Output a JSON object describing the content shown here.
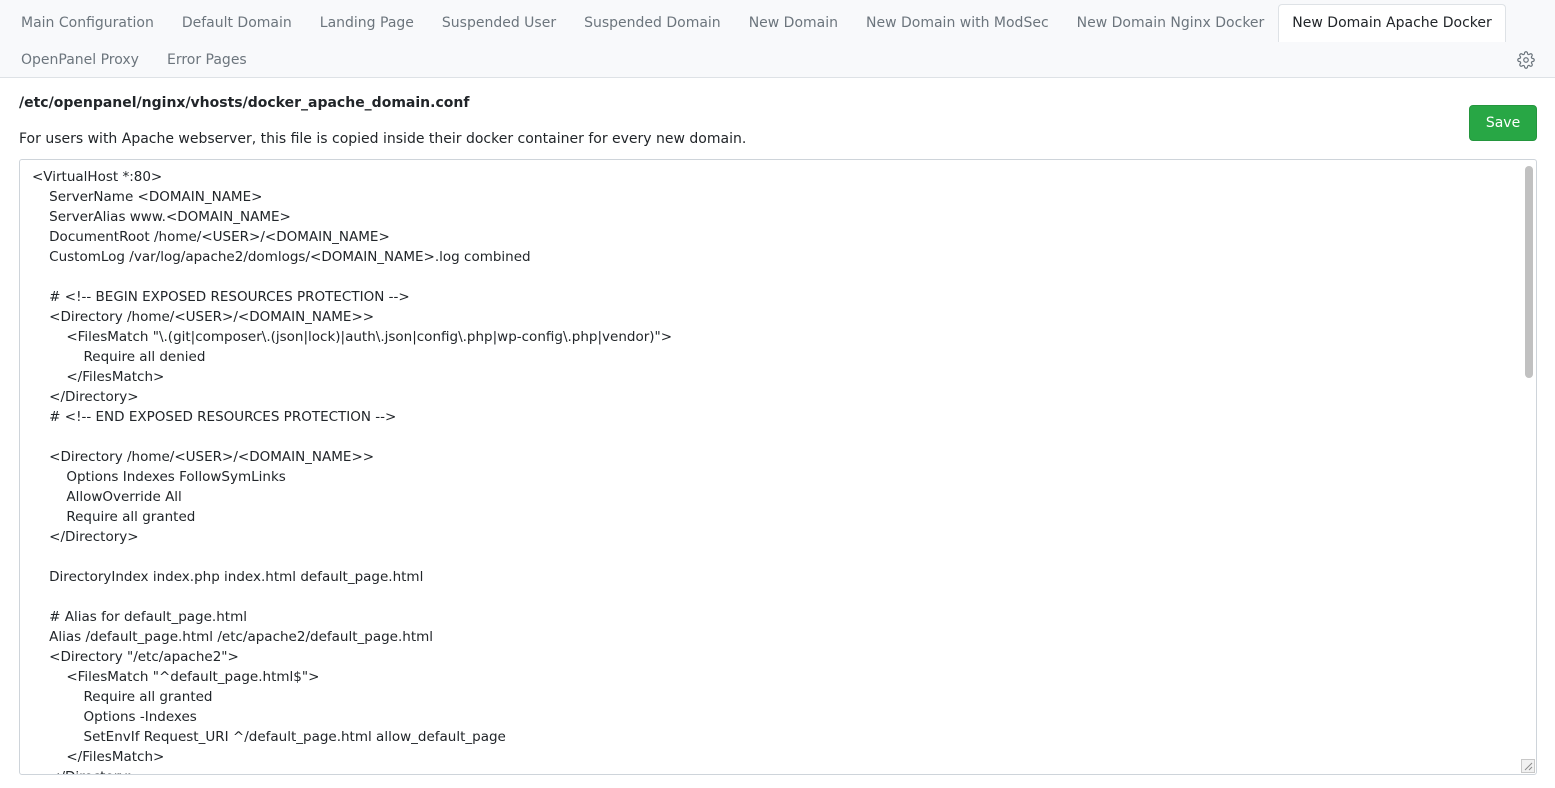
{
  "tabs": {
    "row1": [
      {
        "label": "Main Configuration",
        "active": false
      },
      {
        "label": "Default Domain",
        "active": false
      },
      {
        "label": "Landing Page",
        "active": false
      },
      {
        "label": "Suspended User",
        "active": false
      },
      {
        "label": "Suspended Domain",
        "active": false
      },
      {
        "label": "New Domain",
        "active": false
      },
      {
        "label": "New Domain with ModSec",
        "active": false
      },
      {
        "label": "New Domain Nginx Docker",
        "active": false
      },
      {
        "label": "New Domain Apache Docker",
        "active": true
      }
    ],
    "row2": [
      {
        "label": "OpenPanel Proxy",
        "active": false
      },
      {
        "label": "Error Pages",
        "active": false
      }
    ]
  },
  "settings_icon": "gear-icon",
  "file": {
    "path": "/etc/openpanel/nginx/vhosts/docker_apache_domain.conf",
    "description": "For users with Apache webserver, this file is copied inside their docker container for every new domain."
  },
  "toolbar": {
    "save_label": "Save"
  },
  "colors": {
    "save_button": "#28a745",
    "tab_bar_background": "#f8f9fb",
    "inactive_tab_text": "#6c757d"
  },
  "editor": {
    "content": "<VirtualHost *:80>\n    ServerName <DOMAIN_NAME>\n    ServerAlias www.<DOMAIN_NAME>\n    DocumentRoot /home/<USER>/<DOMAIN_NAME>\n    CustomLog /var/log/apache2/domlogs/<DOMAIN_NAME>.log combined\n\n    # <!-- BEGIN EXPOSED RESOURCES PROTECTION -->\n    <Directory /home/<USER>/<DOMAIN_NAME>>\n        <FilesMatch \"\\.(git|composer\\.(json|lock)|auth\\.json|config\\.php|wp-config\\.php|vendor)\">\n            Require all denied\n        </FilesMatch>\n    </Directory>\n    # <!-- END EXPOSED RESOURCES PROTECTION -->\n\n    <Directory /home/<USER>/<DOMAIN_NAME>>\n        Options Indexes FollowSymLinks\n        AllowOverride All\n        Require all granted\n    </Directory>\n\n    DirectoryIndex index.php index.html default_page.html\n\n    # Alias for default_page.html\n    Alias /default_page.html /etc/apache2/default_page.html\n    <Directory \"/etc/apache2\">\n        <FilesMatch \"^default_page.html$\">\n            Require all granted\n            Options -Indexes\n            SetEnvIf Request_URI ^/default_page.html allow_default_page\n        </FilesMatch>\n    </Directory>"
  }
}
